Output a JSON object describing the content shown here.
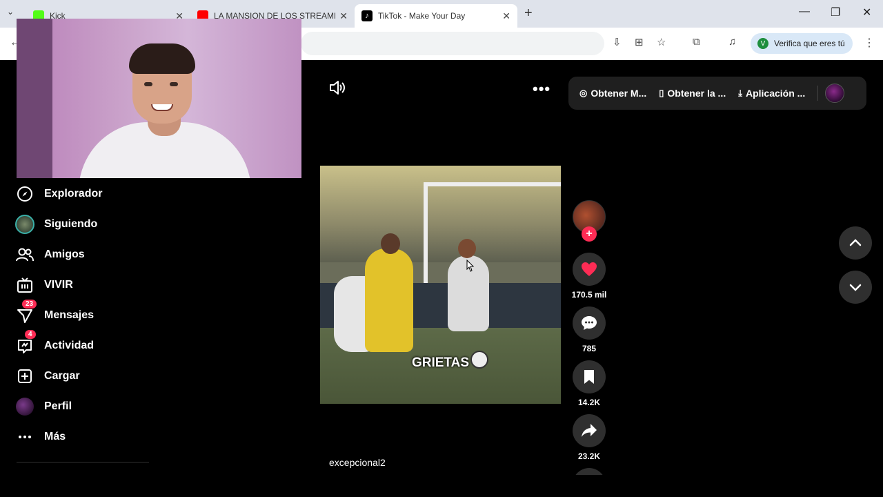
{
  "browser": {
    "tabs": [
      {
        "title": "Kick",
        "favicon_color": "#53fc18"
      },
      {
        "title": "LA MANSION DE LOS STREAMERS",
        "favicon_color": "#ff0000"
      },
      {
        "title": "TikTok - Make Your Day",
        "favicon_color": "#000000"
      }
    ],
    "verify_label": "Verifica que eres tú",
    "verify_initial": "V"
  },
  "sidebar": {
    "items": [
      {
        "label": "Explorador",
        "icon": "compass-icon"
      },
      {
        "label": "Siguiendo",
        "icon": "following-avatar"
      },
      {
        "label": "Amigos",
        "icon": "friends-icon"
      },
      {
        "label": "VIVIR",
        "icon": "live-tv-icon"
      },
      {
        "label": "Mensajes",
        "icon": "messages-icon",
        "badge": "23"
      },
      {
        "label": "Actividad",
        "icon": "activity-icon",
        "badge": "4"
      },
      {
        "label": "Cargar",
        "icon": "upload-icon"
      },
      {
        "label": "Perfil",
        "icon": "profile-avatar"
      },
      {
        "label": "Más",
        "icon": "more-dots-icon"
      }
    ]
  },
  "promo": {
    "items": [
      {
        "label": "Obtener M...",
        "icon": "coin-icon"
      },
      {
        "label": "Obtener la ...",
        "icon": "phone-icon"
      },
      {
        "label": "Aplicación ...",
        "icon": "download-icon"
      }
    ]
  },
  "video": {
    "caption": "GRIETAS",
    "username": "excepcional2"
  },
  "actions": {
    "likes": "170.5 mil",
    "comments": "785",
    "saves": "14.2K",
    "shares": "23.2K"
  },
  "colors": {
    "accent": "#fe2c55",
    "background": "#000000",
    "action_bg": "#2f2f2f"
  }
}
